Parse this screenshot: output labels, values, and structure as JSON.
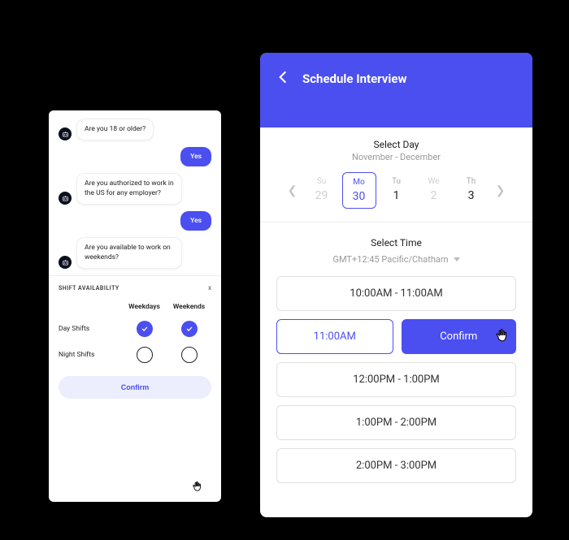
{
  "chat": {
    "messages": [
      {
        "role": "bot",
        "text": "Are you 18 or older?"
      },
      {
        "role": "user",
        "text": "Yes"
      },
      {
        "role": "bot",
        "text": "Are you authorized to work in the US for any employer?"
      },
      {
        "role": "user",
        "text": "Yes"
      },
      {
        "role": "bot",
        "text": "Are you available to work on weekends?"
      }
    ],
    "shift": {
      "title": "SHIFT AVAILABILITY",
      "close": "x",
      "col1": "Weekdays",
      "col2": "Weekends",
      "row1": "Day Shifts",
      "row2": "Night Shifts",
      "confirm": "Confirm"
    }
  },
  "schedule": {
    "title": "Schedule Interview",
    "select_day": "Select Day",
    "month_range": "November - December",
    "days": [
      {
        "dow": "Su",
        "num": "29",
        "state": "disabled"
      },
      {
        "dow": "Mo",
        "num": "30",
        "state": "selected"
      },
      {
        "dow": "Tu",
        "num": "1",
        "state": "normal"
      },
      {
        "dow": "We",
        "num": "2",
        "state": "disabled"
      },
      {
        "dow": "Th",
        "num": "3",
        "state": "normal"
      }
    ],
    "select_time": "Select Time",
    "tz": "GMT+12:45 Pacific/Chatham",
    "slots": {
      "s1": "10:00AM - 11:00AM",
      "sel": "11:00AM",
      "confirm": "Confirm",
      "s3": "12:00PM - 1:00PM",
      "s4": "1:00PM - 2:00PM",
      "s5": "2:00PM - 3:00PM"
    }
  }
}
